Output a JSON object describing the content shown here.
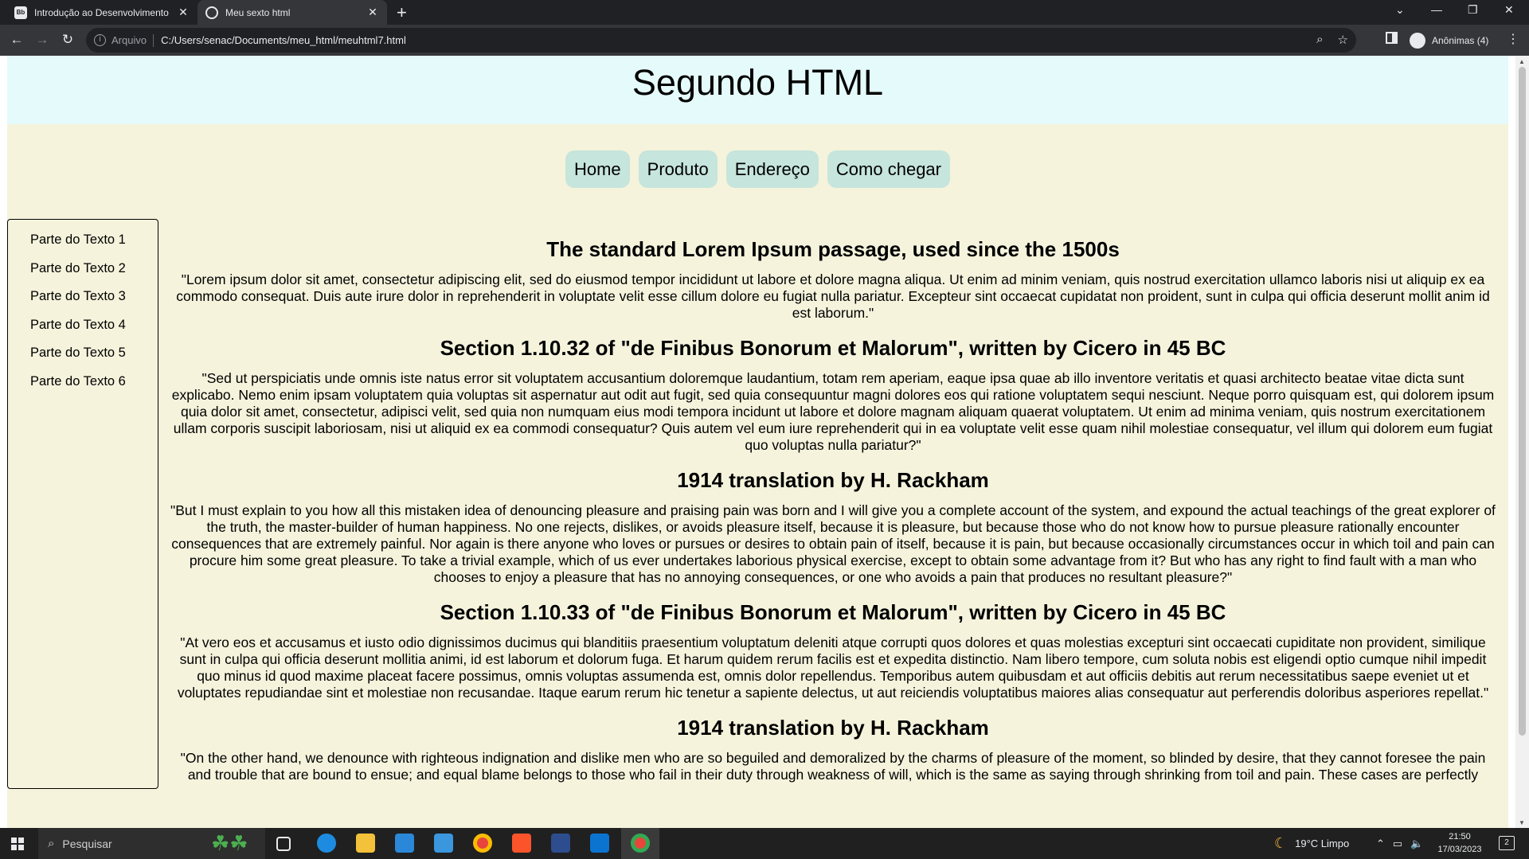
{
  "browser": {
    "tabs": [
      {
        "title": "Introdução ao Desenvolvimento",
        "favicon": "bb-logo-icon",
        "active": false
      },
      {
        "title": "Meu sexto html",
        "favicon": "globe-icon",
        "active": true
      }
    ],
    "new_tab_symbol": "+",
    "address": {
      "scheme_label": "Arquivo",
      "url": "C:/Users/senac/Documents/meu_html/meuhtml7.html"
    },
    "profile_label": "Anônimas (4)"
  },
  "page": {
    "title": "Segundo HTML",
    "menu": [
      "Home",
      "Produto",
      "Endereço",
      "Como chegar"
    ],
    "sidebar": [
      "Parte do Texto 1",
      "Parte do Texto 2",
      "Parte do Texto 3",
      "Parte do Texto 4",
      "Parte do Texto 5",
      "Parte do Texto 6"
    ],
    "sections": [
      {
        "heading": "The standard Lorem Ipsum passage, used since the 1500s",
        "text": "\"Lorem ipsum dolor sit amet, consectetur adipiscing elit, sed do eiusmod tempor incididunt ut labore et dolore magna aliqua. Ut enim ad minim veniam, quis nostrud exercitation ullamco laboris nisi ut aliquip ex ea commodo consequat. Duis aute irure dolor in reprehenderit in voluptate velit esse cillum dolore eu fugiat nulla pariatur. Excepteur sint occaecat cupidatat non proident, sunt in culpa qui officia deserunt mollit anim id est laborum.\""
      },
      {
        "heading": "Section 1.10.32 of \"de Finibus Bonorum et Malorum\", written by Cicero in 45 BC",
        "text": "\"Sed ut perspiciatis unde omnis iste natus error sit voluptatem accusantium doloremque laudantium, totam rem aperiam, eaque ipsa quae ab illo inventore veritatis et quasi architecto beatae vitae dicta sunt explicabo. Nemo enim ipsam voluptatem quia voluptas sit aspernatur aut odit aut fugit, sed quia consequuntur magni dolores eos qui ratione voluptatem sequi nesciunt. Neque porro quisquam est, qui dolorem ipsum quia dolor sit amet, consectetur, adipisci velit, sed quia non numquam eius modi tempora incidunt ut labore et dolore magnam aliquam quaerat voluptatem. Ut enim ad minima veniam, quis nostrum exercitationem ullam corporis suscipit laboriosam, nisi ut aliquid ex ea commodi consequatur? Quis autem vel eum iure reprehenderit qui in ea voluptate velit esse quam nihil molestiae consequatur, vel illum qui dolorem eum fugiat quo voluptas nulla pariatur?\""
      },
      {
        "heading": "1914 translation by H. Rackham",
        "text": "\"But I must explain to you how all this mistaken idea of denouncing pleasure and praising pain was born and I will give you a complete account of the system, and expound the actual teachings of the great explorer of the truth, the master-builder of human happiness. No one rejects, dislikes, or avoids pleasure itself, because it is pleasure, but because those who do not know how to pursue pleasure rationally encounter consequences that are extremely painful. Nor again is there anyone who loves or pursues or desires to obtain pain of itself, because it is pain, but because occasionally circumstances occur in which toil and pain can procure him some great pleasure. To take a trivial example, which of us ever undertakes laborious physical exercise, except to obtain some advantage from it? But who has any right to find fault with a man who chooses to enjoy a pleasure that has no annoying consequences, or one who avoids a pain that produces no resultant pleasure?\""
      },
      {
        "heading": "Section 1.10.33 of \"de Finibus Bonorum et Malorum\", written by Cicero in 45 BC",
        "text": "\"At vero eos et accusamus et iusto odio dignissimos ducimus qui blanditiis praesentium voluptatum deleniti atque corrupti quos dolores et quas molestias excepturi sint occaecati cupiditate non provident, similique sunt in culpa qui officia deserunt mollitia animi, id est laborum et dolorum fuga. Et harum quidem rerum facilis est et expedita distinctio. Nam libero tempore, cum soluta nobis est eligendi optio cumque nihil impedit quo minus id quod maxime placeat facere possimus, omnis voluptas assumenda est, omnis dolor repellendus. Temporibus autem quibusdam et aut officiis debitis aut rerum necessitatibus saepe eveniet ut et voluptates repudiandae sint et molestiae non recusandae. Itaque earum rerum hic tenetur a sapiente delectus, ut aut reiciendis voluptatibus maiores alias consequatur aut perferendis doloribus asperiores repellat.\""
      },
      {
        "heading": "1914 translation by H. Rackham",
        "text": "\"On the other hand, we denounce with righteous indignation and dislike men who are so beguiled and demoralized by the charms of pleasure of the moment, so blinded by desire, that they cannot foresee the pain and trouble that are bound to ensue; and equal blame belongs to those who fail in their duty through weakness of will, which is the same as saying through shrinking from toil and pain. These cases are perfectly"
      }
    ]
  },
  "taskbar": {
    "search_placeholder": "Pesquisar",
    "weather": "19°C  Limpo",
    "time": "21:50",
    "date": "17/03/2023",
    "notification_count": "2",
    "apps": [
      "task-view-icon",
      "edge-icon",
      "file-explorer-icon",
      "store-icon",
      "mail-icon",
      "chrome-icon",
      "brave-icon",
      "powershell-icon",
      "vscode-icon",
      "chrome-incognito-icon"
    ]
  },
  "colors": {
    "page_bg": "#f5f3dc",
    "header_bg": "#e5fafa",
    "menu_button_bg": "#c6e5dc"
  }
}
